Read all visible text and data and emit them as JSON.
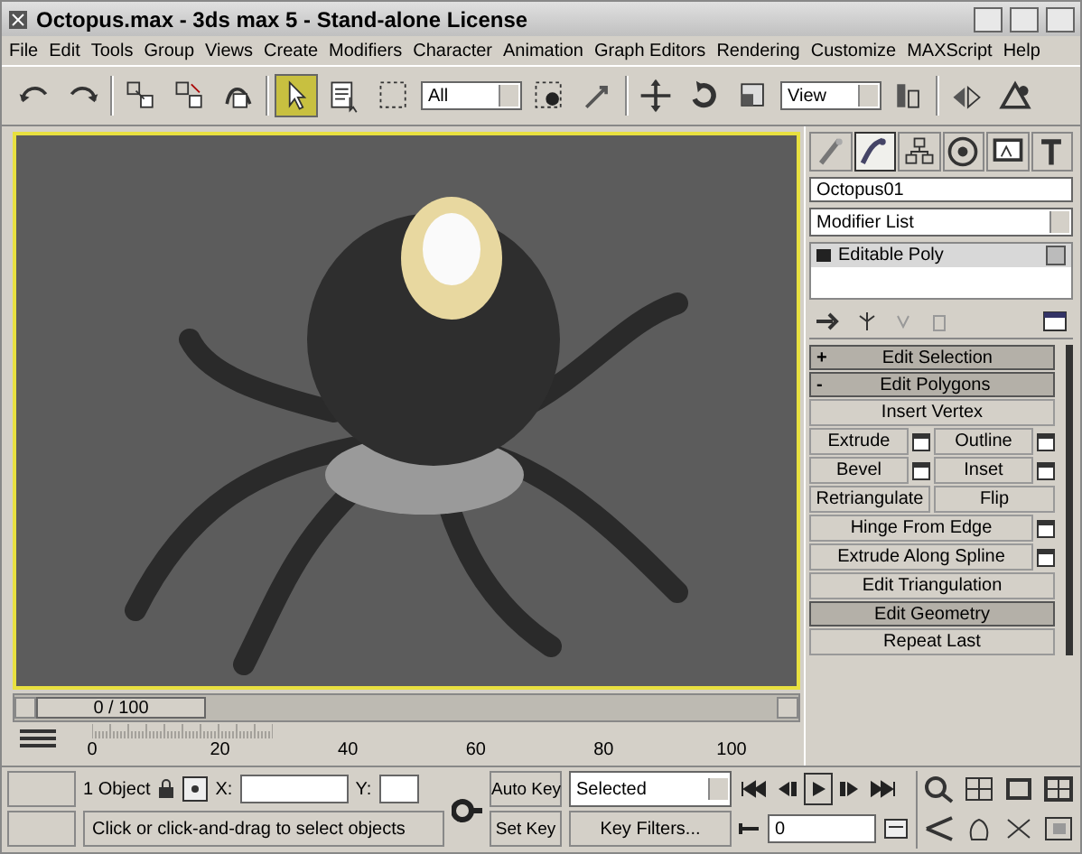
{
  "window": {
    "title": "Octopus.max - 3ds max 5 - Stand-alone License"
  },
  "menu": [
    "File",
    "Edit",
    "Tools",
    "Group",
    "Views",
    "Create",
    "Modifiers",
    "Character",
    "Animation",
    "Graph Editors",
    "Rendering",
    "Customize",
    "MAXScript",
    "Help"
  ],
  "toolbar": [
    {
      "kind": "undo",
      "selected": false
    },
    {
      "kind": "redo",
      "selected": false
    },
    {
      "kind": "sep"
    },
    {
      "kind": "link",
      "selected": false
    },
    {
      "kind": "unlink",
      "selected": false
    },
    {
      "kind": "bind",
      "selected": false
    },
    {
      "kind": "sep"
    },
    {
      "kind": "select",
      "selected": true
    },
    {
      "kind": "select-by-name",
      "selected": false
    },
    {
      "kind": "region",
      "selected": false
    },
    {
      "kind": "dropdown",
      "value": "All"
    },
    {
      "kind": "window",
      "selected": false
    },
    {
      "kind": "pointer",
      "selected": false
    },
    {
      "kind": "sep"
    },
    {
      "kind": "move",
      "selected": false
    },
    {
      "kind": "rotate",
      "selected": false
    },
    {
      "kind": "scale",
      "selected": false
    },
    {
      "kind": "dropdown",
      "value": "View"
    },
    {
      "kind": "pivot",
      "selected": false
    },
    {
      "kind": "sep"
    },
    {
      "kind": "mirror",
      "selected": false
    },
    {
      "kind": "align",
      "selected": false
    }
  ],
  "command_panel": {
    "tabs": [
      {
        "kind": "create",
        "selected": false
      },
      {
        "kind": "modify",
        "selected": true
      },
      {
        "kind": "hierarchy",
        "selected": false
      },
      {
        "kind": "motion",
        "selected": false
      },
      {
        "kind": "display",
        "selected": false
      },
      {
        "kind": "utilities",
        "selected": false
      }
    ],
    "object_name": "Octopus01",
    "modifier_list": "Modifier List",
    "stack": [
      {
        "label": "Editable Poly",
        "selected": false
      }
    ],
    "rollouts": [
      {
        "sign": "+",
        "title": "Edit Selection"
      },
      {
        "sign": "-",
        "title": "Edit Polygons",
        "rows": [
          [
            {
              "label": "Insert Vertex",
              "settings": false
            }
          ],
          [
            {
              "label": "Extrude",
              "settings": true
            },
            {
              "label": "Outline",
              "settings": true
            }
          ],
          [
            {
              "label": "Bevel",
              "settings": true
            },
            {
              "label": "Inset",
              "settings": true
            }
          ],
          [
            {
              "label": "Retriangulate",
              "settings": false
            },
            {
              "label": "Flip",
              "settings": false
            }
          ],
          [
            {
              "label": "Hinge From Edge",
              "settings": true
            }
          ],
          [
            {
              "label": "Extrude Along Spline",
              "settings": true
            }
          ],
          [
            {
              "label": "Edit Triangulation",
              "settings": false
            }
          ]
        ]
      },
      {
        "title": "Edit Geometry",
        "rows": [
          [
            {
              "label": "Repeat Last",
              "settings": false
            }
          ]
        ]
      }
    ]
  },
  "time_slider": {
    "label": "0 / 100",
    "level": 0
  },
  "track_bar": {
    "ticks": [
      "0",
      "20",
      "40",
      "60",
      "80",
      "100"
    ]
  },
  "status": {
    "selection": "1 Object",
    "x_label": "X:",
    "y_label": "Y:",
    "prompt": "Click or click-and-drag to select objects",
    "auto_key": "Auto Key",
    "set_key": "Set Key",
    "key_mode": "Selected",
    "key_filters": "Key Filters...",
    "frame": "0"
  }
}
